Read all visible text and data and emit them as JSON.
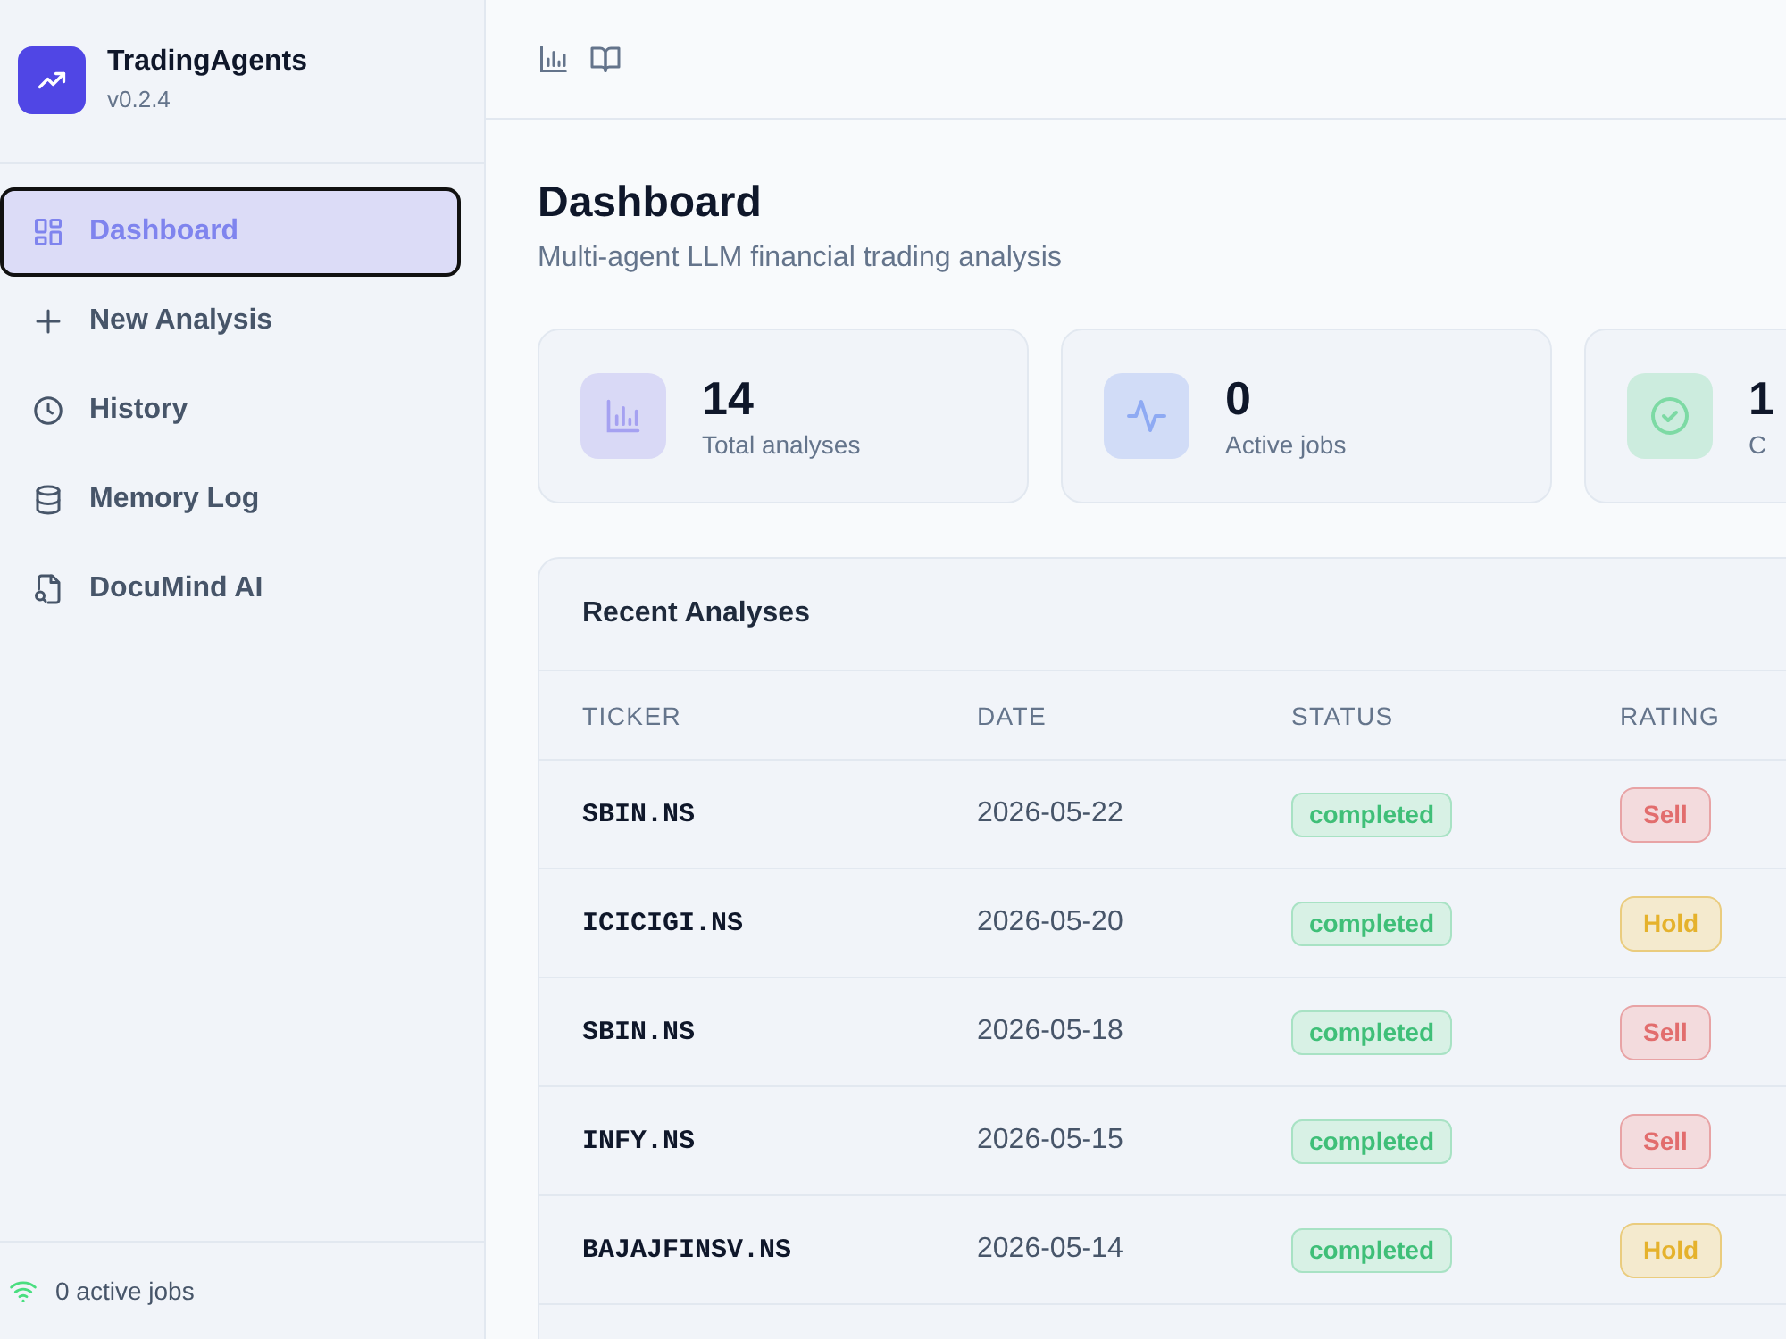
{
  "sidebar": {
    "brand": {
      "name": "TradingAgents",
      "version": "v0.2.4"
    },
    "items": [
      {
        "label": "Dashboard",
        "selected": true
      },
      {
        "label": "New Analysis",
        "selected": false
      },
      {
        "label": "History",
        "selected": false
      },
      {
        "label": "Memory Log",
        "selected": false
      },
      {
        "label": "DocuMind AI",
        "selected": false
      }
    ],
    "footer": {
      "status": "0 active jobs"
    }
  },
  "page": {
    "title": "Dashboard",
    "subtitle": "Multi-agent LLM financial trading analysis"
  },
  "stats": [
    {
      "value": "14",
      "label": "Total analyses",
      "color": "#a5a1f1"
    },
    {
      "value": "0",
      "label": "Active jobs",
      "color": "#8eaaf3"
    },
    {
      "value": "1",
      "label": "C",
      "color": "#7ddaa4"
    }
  ],
  "recent": {
    "title": "Recent Analyses",
    "columns": [
      "TICKER",
      "DATE",
      "STATUS",
      "RATING"
    ],
    "rows": [
      {
        "ticker": "SBIN.NS",
        "date": "2026-05-22",
        "status": "completed",
        "rating": {
          "label": "Sell",
          "color": "#e26d6d"
        }
      },
      {
        "ticker": "ICICIGI.NS",
        "date": "2026-05-20",
        "status": "completed",
        "rating": {
          "label": "Hold",
          "color": "#e5b22c"
        }
      },
      {
        "ticker": "SBIN.NS",
        "date": "2026-05-18",
        "status": "completed",
        "rating": {
          "label": "Sell",
          "color": "#e26d6d"
        }
      },
      {
        "ticker": "INFY.NS",
        "date": "2026-05-15",
        "status": "completed",
        "rating": {
          "label": "Sell",
          "color": "#e26d6d"
        }
      },
      {
        "ticker": "BAJAJFINSV.NS",
        "date": "2026-05-14",
        "status": "completed",
        "rating": {
          "label": "Hold",
          "color": "#e5b22c"
        }
      }
    ]
  }
}
